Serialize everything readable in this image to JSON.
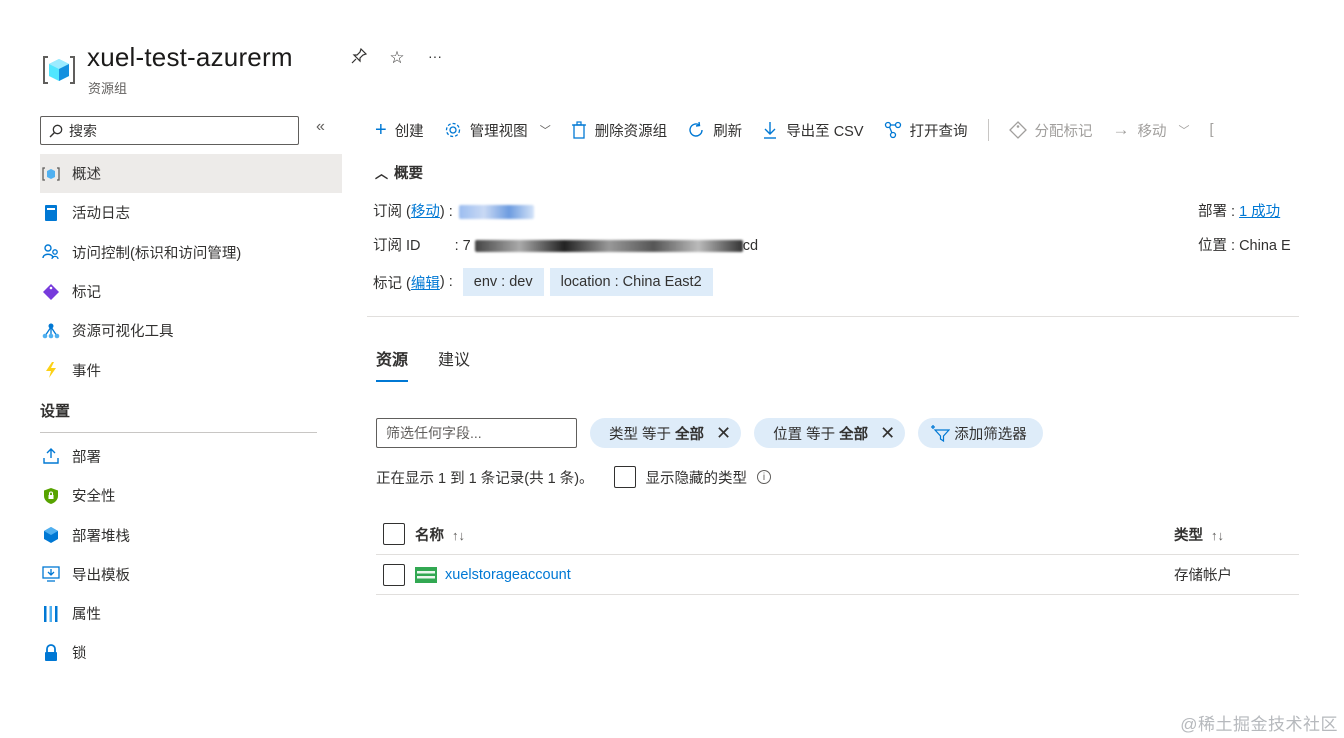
{
  "header": {
    "title": "xuel-test-azurerm",
    "subtitle": "资源组",
    "icons": [
      "pin-icon",
      "star-icon",
      "more-icon"
    ]
  },
  "sidebar": {
    "search_placeholder": "搜索",
    "items": [
      {
        "label": "概述",
        "icon": "overview-icon",
        "active": true
      },
      {
        "label": "活动日志",
        "icon": "activity-log-icon"
      },
      {
        "label": "访问控制(标识和访问管理)",
        "icon": "iam-icon"
      },
      {
        "label": "标记",
        "icon": "tag-icon"
      },
      {
        "label": "资源可视化工具",
        "icon": "visualizer-icon"
      },
      {
        "label": "事件",
        "icon": "events-icon"
      }
    ],
    "section_settings": "设置",
    "settings_items": [
      {
        "label": "部署",
        "icon": "deploy-icon"
      },
      {
        "label": "安全性",
        "icon": "security-icon"
      },
      {
        "label": "部署堆栈",
        "icon": "stack-icon"
      },
      {
        "label": "导出模板",
        "icon": "export-template-icon"
      },
      {
        "label": "属性",
        "icon": "properties-icon"
      },
      {
        "label": "锁",
        "icon": "lock-icon"
      }
    ]
  },
  "toolbar": {
    "create": "创建",
    "manage_view": "管理视图",
    "delete_rg": "删除资源组",
    "refresh": "刷新",
    "export_csv": "导出至 CSV",
    "open_query": "打开查询",
    "assign_tags": "分配标记",
    "move": "移动"
  },
  "essentials": {
    "toggle": "概要",
    "subscription_label": "订阅 (",
    "subscription_move": "移动",
    "subscription_suffix": ") :",
    "subscription_id_label": "订阅 ID",
    "subscription_id_prefix": ": 7",
    "subscription_id_suffix": "cd",
    "tags_label": "标记 (",
    "tags_edit": "编辑",
    "tags_suffix": ") :",
    "tags": [
      "env : dev",
      "location : China East2"
    ],
    "deployments_label": "部署 : ",
    "deployments_value": "1 成功",
    "location_label": "位置 : China E"
  },
  "tabs": {
    "resources": "资源",
    "recommendations": "建议"
  },
  "filters": {
    "placeholder": "筛选任何字段...",
    "type_filter_prefix": "类型 等于",
    "type_filter_value": "全部",
    "location_filter_prefix": "位置 等于",
    "location_filter_value": "全部",
    "add_filter": "添加筛选器"
  },
  "records": {
    "summary": "正在显示 1 到 1 条记录(共 1 条)。",
    "show_hidden": "显示隐藏的类型"
  },
  "table": {
    "columns": [
      "名称",
      "类型"
    ],
    "rows": [
      {
        "name": "xuelstorageaccount",
        "type": "存储帐户"
      }
    ]
  },
  "watermark": "@稀土掘金技术社区"
}
